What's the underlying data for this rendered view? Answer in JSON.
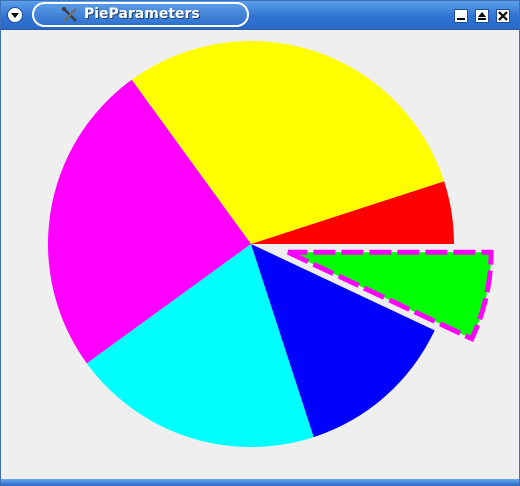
{
  "window": {
    "title": "PieParameters",
    "menu_icon": "chevron-down-icon",
    "app_icon": "tools-icon",
    "buttons": [
      "minimize-icon",
      "maximize-icon",
      "close-icon"
    ]
  },
  "chart_data": {
    "type": "pie",
    "slices": [
      {
        "value": 5,
        "color": "#ff0000",
        "exploded": false
      },
      {
        "value": 30,
        "color": "#ffff00",
        "exploded": false
      },
      {
        "value": 25,
        "color": "#ff00ff",
        "exploded": false
      },
      {
        "value": 20,
        "color": "#00ffff",
        "exploded": false
      },
      {
        "value": 13,
        "color": "#0000ff",
        "exploded": false
      },
      {
        "value": 7,
        "color": "#00ff00",
        "exploded": true,
        "outline_color": "#ff00ff",
        "outline_style": "dashed"
      }
    ],
    "start_direction": "counterclockwise-from-east",
    "legend": "none"
  }
}
